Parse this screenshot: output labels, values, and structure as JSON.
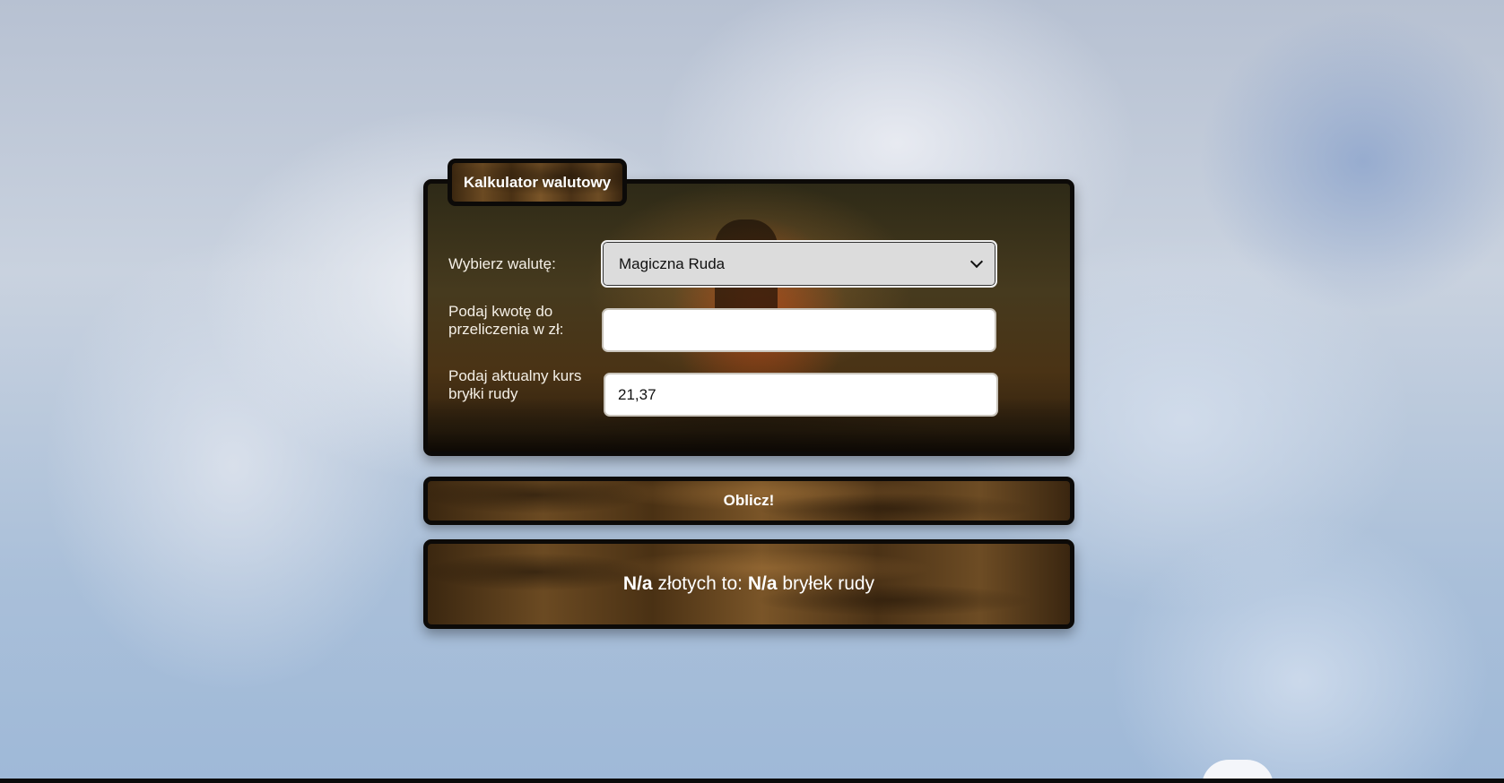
{
  "calculator": {
    "title": "Kalkulator walutowy",
    "currency_label": "Wybierz walutę:",
    "currency_selected": "Magiczna Ruda",
    "amount_label_line1": "Podaj kwotę do",
    "amount_label_line2": "przeliczenia w zł:",
    "amount_value": "",
    "rate_label_line1": "Podaj aktualny kurs",
    "rate_label_line2": "bryłki rudy",
    "rate_value": "21,37",
    "button_label": "Oblicz!"
  },
  "result": {
    "amount": "N/a",
    "text_middle": " złotych to: ",
    "converted": "N/a",
    "text_end": " bryłek rudy"
  }
}
